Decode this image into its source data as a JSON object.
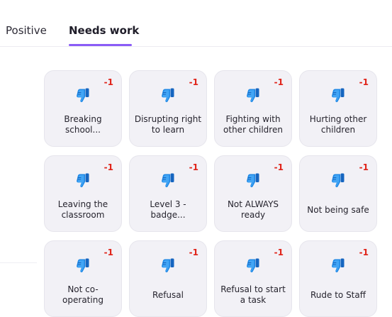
{
  "tabs": [
    {
      "label": "Positive",
      "active": false
    },
    {
      "label": "Needs work",
      "active": true
    }
  ],
  "accent_color": "#8a5cf6",
  "points_color": "#e0241a",
  "icon": "thumbs-down-icon",
  "cards": [
    {
      "label": "Breaking school...",
      "points": "-1"
    },
    {
      "label": "Disrupting right to learn",
      "points": "-1"
    },
    {
      "label": "Fighting with other children",
      "points": "-1"
    },
    {
      "label": "Hurting other children",
      "points": "-1"
    },
    {
      "label": "Leaving the classroom",
      "points": "-1"
    },
    {
      "label": "Level 3 - badge...",
      "points": "-1"
    },
    {
      "label": "Not ALWAYS ready",
      "points": "-1"
    },
    {
      "label": "Not being safe",
      "points": "-1"
    },
    {
      "label": "Not co-operating",
      "points": "-1"
    },
    {
      "label": "Refusal",
      "points": "-1"
    },
    {
      "label": "Refusal to start a task",
      "points": "-1"
    },
    {
      "label": "Rude to Staff",
      "points": "-1"
    }
  ]
}
